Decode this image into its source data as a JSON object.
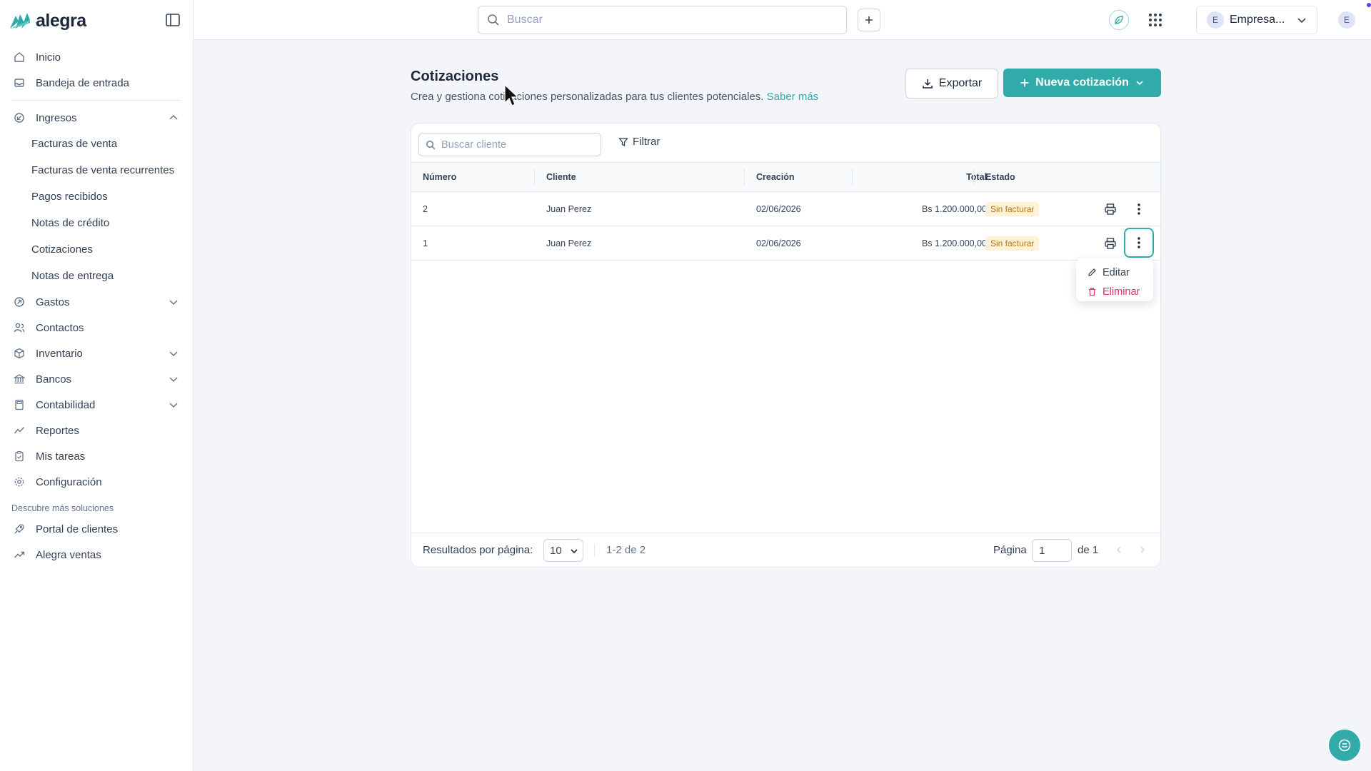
{
  "brand": {
    "name": "alegra",
    "accent": "#30aba9"
  },
  "topbar": {
    "search_placeholder": "Buscar",
    "company_initial": "E",
    "company_name": "Empresa...",
    "user_initial": "E"
  },
  "sidebar": {
    "items": [
      {
        "label": "Inicio",
        "icon": "home-icon"
      },
      {
        "label": "Bandeja de entrada",
        "icon": "inbox-icon"
      }
    ],
    "ingresos": {
      "label": "Ingresos",
      "expanded": true,
      "sub_items": [
        "Facturas de venta",
        "Facturas de venta recurrentes",
        "Pagos recibidos",
        "Notas de crédito",
        "Cotizaciones",
        "Notas de entrega"
      ]
    },
    "more_items": [
      {
        "label": "Gastos",
        "icon": "expenses-icon",
        "expandable": true
      },
      {
        "label": "Contactos",
        "icon": "contacts-icon",
        "expandable": false
      },
      {
        "label": "Inventario",
        "icon": "box-icon",
        "expandable": true
      },
      {
        "label": "Bancos",
        "icon": "bank-icon",
        "expandable": true
      },
      {
        "label": "Contabilidad",
        "icon": "calculator-icon",
        "expandable": true
      },
      {
        "label": "Reportes",
        "icon": "chart-line-icon",
        "expandable": false
      },
      {
        "label": "Mis tareas",
        "icon": "clipboard-icon",
        "expandable": false
      },
      {
        "label": "Configuración",
        "icon": "gear-icon",
        "expandable": false
      }
    ],
    "discover_label": "Descubre más soluciones",
    "discover_items": [
      {
        "label": "Portal de clientes",
        "icon": "rocket-icon"
      },
      {
        "label": "Alegra ventas",
        "icon": "trend-up-icon"
      }
    ]
  },
  "page": {
    "title": "Cotizaciones",
    "subtitle": "Crea y gestiona cotizaciones personalizadas para tus clientes potenciales.",
    "learn_more": "Saber más",
    "export_label": "Exportar",
    "new_label": "Nueva cotización"
  },
  "table": {
    "search_placeholder": "Buscar cliente",
    "filter_label": "Filtrar",
    "columns": [
      "Número",
      "Cliente",
      "Creación",
      "Total",
      "Estado"
    ],
    "rows": [
      {
        "numero": "2",
        "cliente": "Juan Perez",
        "creacion": "02/06/2026",
        "total": "Bs 1.200.000,00",
        "estado": "Sin facturar"
      },
      {
        "numero": "1",
        "cliente": "Juan Perez",
        "creacion": "02/06/2026",
        "total": "Bs 1.200.000,00",
        "estado": "Sin facturar"
      }
    ],
    "row_menu": {
      "edit": "Editar",
      "delete": "Eliminar"
    }
  },
  "pagination": {
    "per_page_label": "Resultados por página:",
    "per_page_value": "10",
    "range": "1-2 de 2",
    "page_label": "Página",
    "page_value": "1",
    "of_label": "de 1"
  },
  "colors": {
    "status_badge_bg": "#fdf1d8",
    "status_badge_fg": "#b9770e",
    "danger": "#e0345f"
  }
}
